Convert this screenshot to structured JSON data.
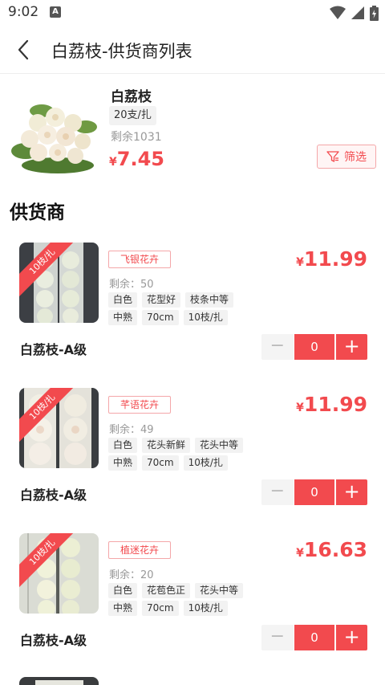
{
  "status_bar": {
    "time": "9:02",
    "notification_icon": "A"
  },
  "header": {
    "title": "白荔枝-供货商列表"
  },
  "product": {
    "name": "白荔枝",
    "spec": "20支/扎",
    "stock": "剩余1031",
    "currency": "¥",
    "price": "7.45",
    "filter_label": "筛选"
  },
  "section_title": "供货商",
  "suppliers": [
    {
      "ribbon": "10枝/扎",
      "tag": "飞银花卉",
      "stock": "剩余：50",
      "attrs_row1": [
        "白色",
        "花型好",
        "枝条中等"
      ],
      "attrs_row2": [
        "中熟",
        "70cm",
        "10枝/扎"
      ],
      "currency": "¥",
      "price": "11.99",
      "name": "白荔枝-A级",
      "qty": "0"
    },
    {
      "ribbon": "10枝/扎",
      "tag": "芊语花卉",
      "stock": "剩余：49",
      "attrs_row1": [
        "白色",
        "花头新鲜",
        "花头中等"
      ],
      "attrs_row2": [
        "中熟",
        "70cm",
        "10枝/扎"
      ],
      "currency": "¥",
      "price": "11.99",
      "name": "白荔枝-A级",
      "qty": "0"
    },
    {
      "ribbon": "10枝/扎",
      "tag": "植迷花卉",
      "stock": "剩余：20",
      "attrs_row1": [
        "白色",
        "花苞色正",
        "花头中等"
      ],
      "attrs_row2": [
        "中熟",
        "70cm",
        "10枝/扎"
      ],
      "currency": "¥",
      "price": "16.63",
      "name": "白荔枝-A级",
      "qty": "0"
    }
  ],
  "stepper": {
    "minus": "−",
    "plus": "+"
  },
  "colors": {
    "accent": "#f24a4e",
    "tag_border": "#f4a7a9",
    "chip_bg": "#f2f2f2",
    "muted_text": "#999999"
  },
  "icons": [
    "back-arrow-icon",
    "wifi-icon",
    "signal-icon",
    "battery-icon",
    "filter-icon"
  ]
}
